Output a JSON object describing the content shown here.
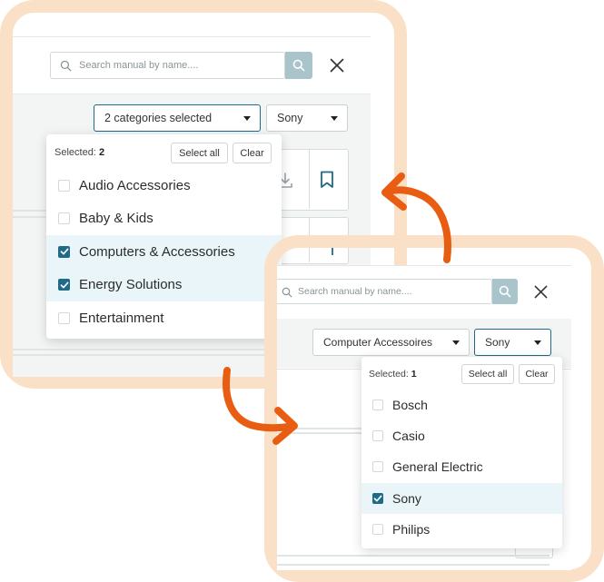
{
  "colors": {
    "frame": "#fbe0c8",
    "arrow": "#e85d12",
    "accent": "#1e6a87",
    "search_button": "#a9c5cb",
    "selected_row": "#e9f5f9"
  },
  "panel_a": {
    "search": {
      "placeholder": "Search manual by name....",
      "icon": "search-icon"
    },
    "close_icon": "close-icon",
    "category_dropdown": {
      "value": "2 categories selected"
    },
    "brand_dropdown": {
      "value": "Sony"
    },
    "menu": {
      "selected_label": "Selected:",
      "selected_count": "2",
      "select_all": "Select all",
      "clear": "Clear",
      "options": [
        {
          "label": "Audio Accessories",
          "checked": false
        },
        {
          "label": "Baby & Kids",
          "checked": false
        },
        {
          "label": "Computers & Accessories",
          "checked": true
        },
        {
          "label": "Energy Solutions",
          "checked": true
        },
        {
          "label": "Entertainment",
          "checked": false
        }
      ]
    },
    "card_icons": [
      "download-icon",
      "bookmark-icon"
    ]
  },
  "panel_b": {
    "search": {
      "placeholder": "Search manual by name....",
      "icon": "search-icon"
    },
    "close_icon": "close-icon",
    "category_dropdown": {
      "value": "Computer Accessoires"
    },
    "brand_dropdown": {
      "value": "Sony"
    },
    "menu": {
      "selected_label": "Selected:",
      "selected_count": "1",
      "select_all": "Select all",
      "clear": "Clear",
      "options": [
        {
          "label": "Bosch",
          "checked": false
        },
        {
          "label": "Casio",
          "checked": false
        },
        {
          "label": "General Electric",
          "checked": false
        },
        {
          "label": "Sony",
          "checked": true
        },
        {
          "label": "Philips",
          "checked": false
        }
      ]
    }
  }
}
